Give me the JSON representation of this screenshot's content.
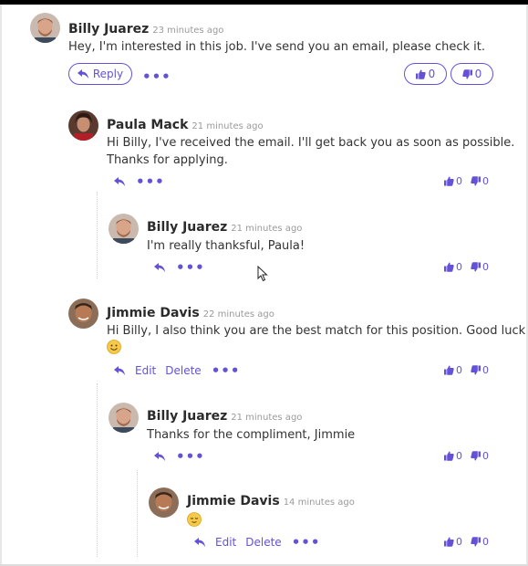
{
  "comments": [
    {
      "author": "Billy Juarez",
      "time": "23 minutes ago",
      "text": "Hey, I'm interested in this job. I've send you an email, please check it.",
      "reply_label": "Reply",
      "likes": "0",
      "dislikes": "0"
    },
    {
      "author": "Paula Mack",
      "time": "21 minutes ago",
      "text1": "Hi Billy, I've received the email. I'll get back you as soon as possible.",
      "text2": "Thanks for applying.",
      "likes": "0",
      "dislikes": "0"
    },
    {
      "author": "Billy Juarez",
      "time": "21 minutes ago",
      "text": "I'm really thanksful, Paula!",
      "likes": "0",
      "dislikes": "0"
    },
    {
      "author": "Jimmie Davis",
      "time": "22 minutes ago",
      "text1": "Hi Billy, I also think you are the best match for this position. Good luck",
      "edit_label": "Edit",
      "delete_label": "Delete",
      "likes": "0",
      "dislikes": "0"
    },
    {
      "author": "Billy Juarez",
      "time": "21 minutes ago",
      "text": "Thanks for the compliment, Jimmie",
      "likes": "0",
      "dislikes": "0"
    },
    {
      "author": "Jimmie Davis",
      "time": "14 minutes ago",
      "edit_label": "Edit",
      "delete_label": "Delete",
      "likes": "0",
      "dislikes": "0"
    }
  ],
  "more_label": "•••",
  "colors": {
    "accent": "#6352d8"
  }
}
